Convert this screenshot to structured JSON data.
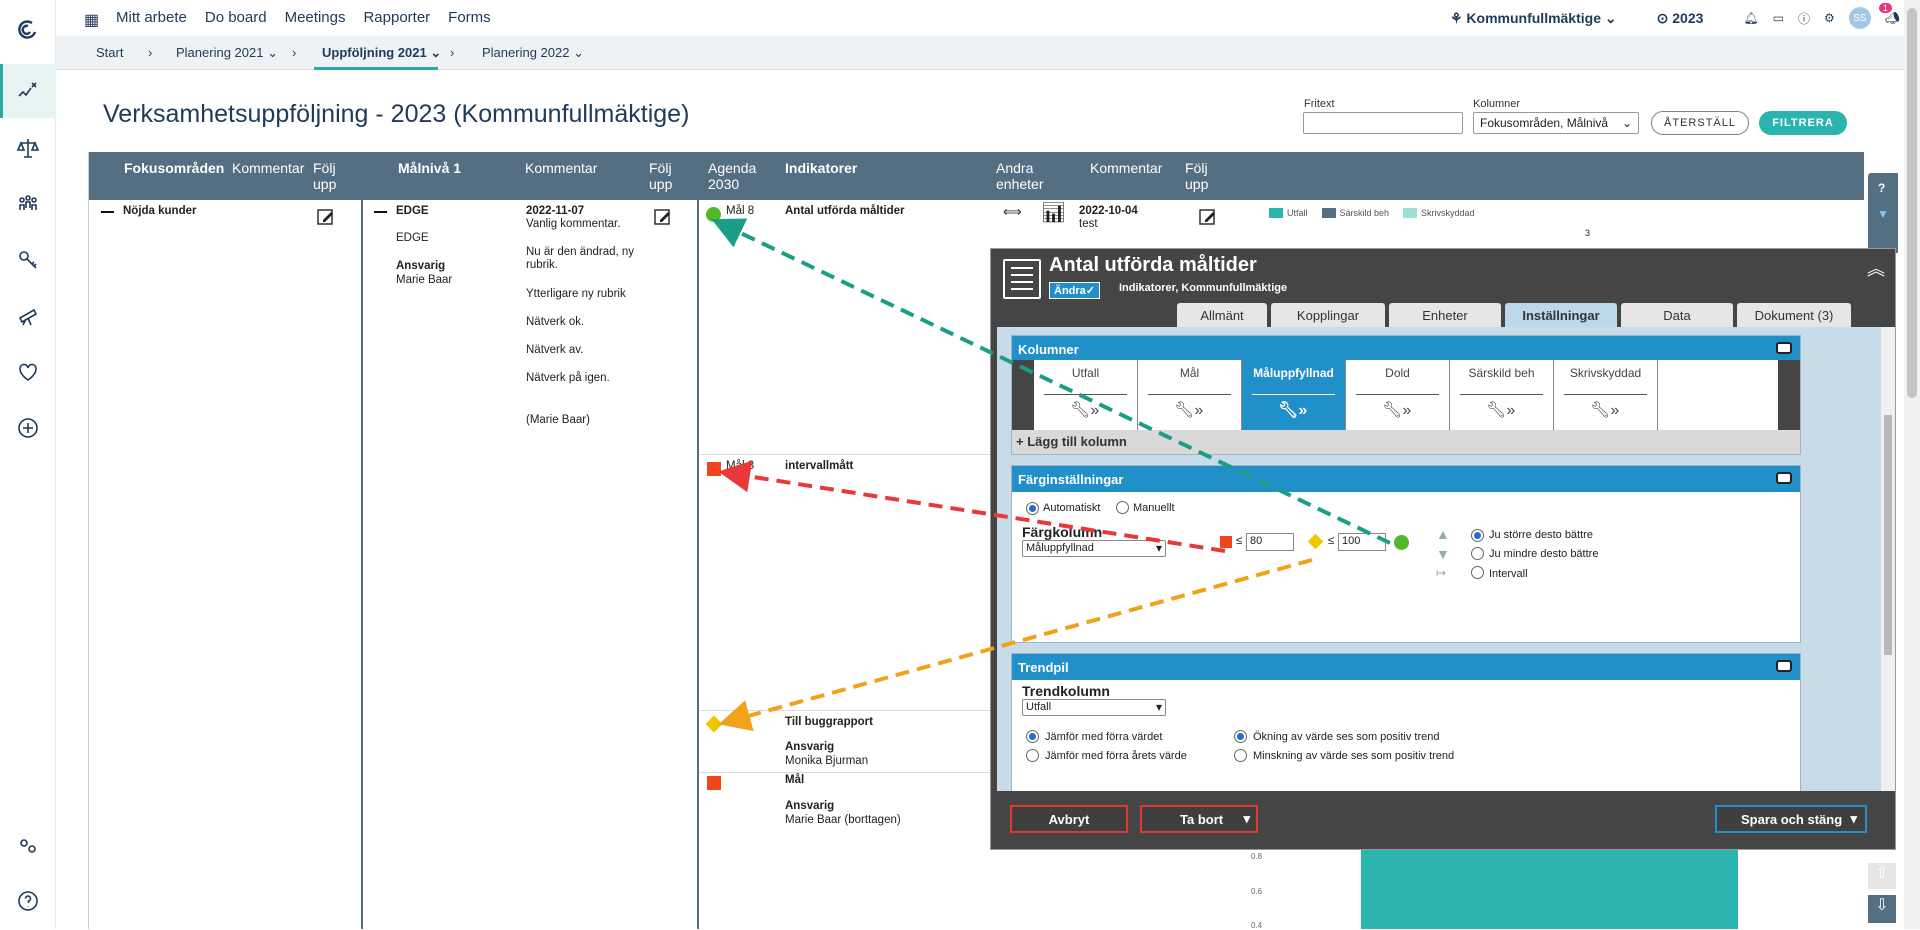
{
  "topnav": {
    "items": [
      "Mitt arbete",
      "Do board",
      "Meetings",
      "Rapporter",
      "Forms"
    ],
    "org": "Kommunfullmäktige",
    "year": "2023",
    "notif_count": "1",
    "avatar": "SS"
  },
  "breadcrumb": {
    "items": [
      "Start",
      "Planering 2021",
      "Uppföljning 2021",
      "Planering 2022"
    ]
  },
  "page": {
    "title": "Verksamhetsuppföljning - 2023 (Kommunfullmäktige)"
  },
  "filter": {
    "fritext_label": "Fritext",
    "fritext_value": "",
    "kolumner_label": "Kolumner",
    "kolumner_value": "Fokusområden, Målnivå",
    "reset": "ÅTERSTÄLL",
    "apply": "FILTRERA"
  },
  "grid": {
    "headers": {
      "fokus": "Fokusområden",
      "kommentar1": "Kommentar",
      "folj1": [
        "Följ",
        "upp"
      ],
      "malniva": "Målnivå 1",
      "kommentar2": "Kommentar",
      "folj2": [
        "Följ",
        "upp"
      ],
      "agenda": [
        "Agenda",
        "2030"
      ],
      "indikatorer": "Indikatorer",
      "andra": [
        "Andra",
        "enheter"
      ],
      "kommentar3": "Kommentar",
      "folj3": [
        "Följ",
        "upp"
      ]
    },
    "fokus_row": "Nöjda kunder",
    "mal": {
      "name": "EDGE",
      "sub": "EDGE",
      "ansvarig_label": "Ansvarig",
      "ansvarig": "Marie Baar"
    },
    "comments": {
      "date": "2022-11-07",
      "lines": [
        "Vanlig kommentar.",
        "Nu är den ändrad, ny",
        "rubrik.",
        "Ytterligare ny rubrik",
        "Nätverk ok.",
        "Nätverk av.",
        "Nätverk på igen.",
        "(Marie Baar)"
      ]
    },
    "indicators": [
      {
        "agenda": "Mål 8",
        "name": "Antal utförda måltider",
        "color": "#52b82a"
      },
      {
        "agenda": "Mål 8",
        "name": "intervallmått",
        "color": "#f0451d"
      },
      {
        "agenda": "",
        "name": "Till buggrapport",
        "ansvarig_label": "Ansvarig",
        "ansvarig": "Monika Bjurman",
        "color": "#f5c400"
      },
      {
        "agenda": "",
        "name": "Mål",
        "ansvarig_label": "Ansvarig",
        "ansvarig": "Marie Baar (borttagen)",
        "color": "#f0451d"
      }
    ],
    "ind_comment": {
      "date": "2022-10-04",
      "text": "test"
    },
    "legend": [
      "Utfall",
      "Särskild beh",
      "Skrivskyddad"
    ],
    "chart_axis": [
      "3",
      "0.8",
      "0.6",
      "0.4"
    ]
  },
  "modal": {
    "title": "Antal utförda måltider",
    "badge": "Ändra✓",
    "subtitle": "Indikatorer, Kommunfullmäktige",
    "tabs": [
      "Allmänt",
      "Kopplingar",
      "Enheter",
      "Inställningar",
      "Data",
      "Dokument (3)"
    ],
    "kolumner": {
      "title": "Kolumner",
      "cols": [
        "Utfall",
        "Mål",
        "Måluppfyllnad",
        "Dold",
        "Särskild beh",
        "Skrivskyddad"
      ],
      "add": "+ Lägg till kolumn"
    },
    "farg": {
      "title": "Färginställningar",
      "auto": "Automatiskt",
      "manual": "Manuellt",
      "kolumn_label": "Färgkolumn",
      "kolumn_value": "Måluppfyllnad",
      "le1": "≤",
      "val1": "80",
      "le2": "≤",
      "val2": "100",
      "opt1": "Ju större desto bättre",
      "opt2": "Ju mindre desto bättre",
      "opt3": "Intervall"
    },
    "trend": {
      "title": "Trendpil",
      "kolumn_label": "Trendkolumn",
      "kolumn_value": "Utfall",
      "r1": "Jämför med förra värdet",
      "r2": "Jämför med förra årets värde",
      "r3": "Ökning av värde ses som positiv trend",
      "r4": "Minskning av värde ses som positiv trend"
    },
    "footer": {
      "cancel": "Avbryt",
      "delete": "Ta bort",
      "save": "Spara och stäng"
    }
  }
}
